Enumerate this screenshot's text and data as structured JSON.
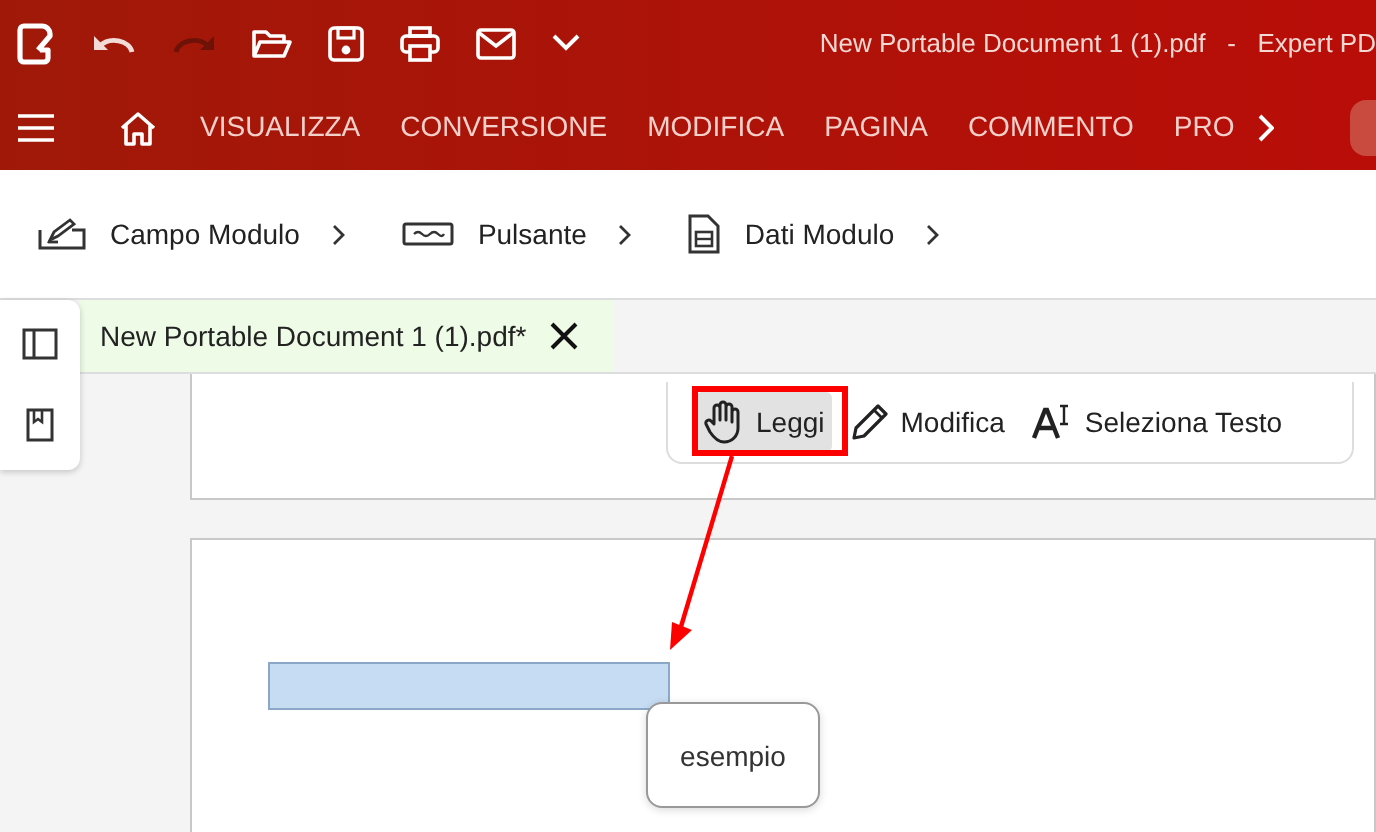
{
  "title_bar": {
    "title": "New Portable Document 1 (1).pdf   -   Expert PD"
  },
  "menu": {
    "tabs": [
      {
        "label": "VISUALIZZA",
        "selected": false
      },
      {
        "label": "CONVERSIONE",
        "selected": false
      },
      {
        "label": "MODIFICA",
        "selected": false
      },
      {
        "label": "PAGINA",
        "selected": false
      },
      {
        "label": "COMMENTO",
        "selected": false
      },
      {
        "label": "PRO",
        "selected": false
      }
    ]
  },
  "ribbon": {
    "items": [
      {
        "label": "Campo Modulo",
        "kind": "field"
      },
      {
        "label": "Pulsante",
        "kind": "button"
      },
      {
        "label": "Dati Modulo",
        "kind": "data"
      }
    ]
  },
  "document_tab": {
    "label": "New Portable Document 1 (1).pdf*",
    "selected": true
  },
  "tools": [
    {
      "label": "Leggi",
      "kind": "hand",
      "selected": true
    },
    {
      "label": "Modifica",
      "kind": "pencil",
      "selected": false
    },
    {
      "label": "Seleziona Testo",
      "kind": "text",
      "selected": false
    }
  ],
  "tooltip": {
    "text": "esempio"
  }
}
